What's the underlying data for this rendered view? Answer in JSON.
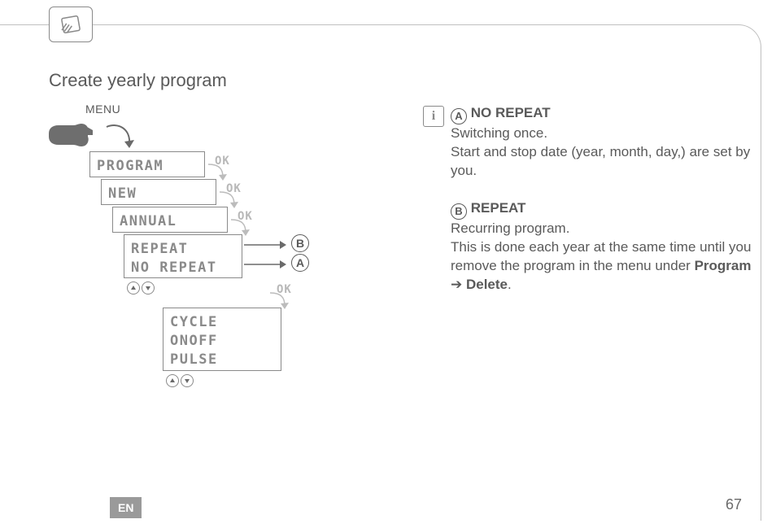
{
  "page": {
    "title": "Create yearly program",
    "lang_badge": "EN",
    "page_number": "67"
  },
  "menu": {
    "label": "MENU",
    "screens": {
      "s1": "PROGRAM",
      "s2": "NEW",
      "s3": "ANNUAL",
      "s4_line1": "REPEAT",
      "s4_line2": "NO REPEAT",
      "s5_line1": "CYCLE",
      "s5_line2": "ONOFF",
      "s5_line3": "PULSE",
      "ok": "OK"
    },
    "refs": {
      "a": "A",
      "b": "B"
    }
  },
  "info": {
    "a_letter": "A",
    "a_title": "NO REPEAT",
    "a_line1": "Switching once.",
    "a_line2": "Start and stop date (year, month, day,) are set by you.",
    "b_letter": "B",
    "b_title": "REPEAT",
    "b_line1": "Recurring program.",
    "b_line2_pre": "This is done each year at the same time until you remove the program in the menu under ",
    "b_line2_bold1": "Program",
    "b_line2_arrow": " ➔ ",
    "b_line2_bold2": "Delete",
    "b_line2_post": "."
  }
}
